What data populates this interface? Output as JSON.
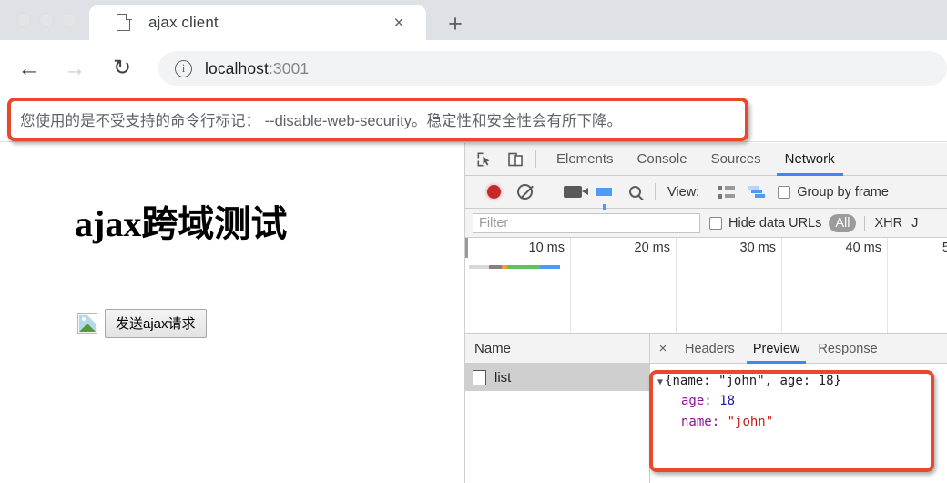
{
  "browser": {
    "tab": {
      "title": "ajax client",
      "favicon": "page-icon",
      "close": "×"
    },
    "new_tab": "+",
    "nav": {
      "back": "←",
      "forward": "→",
      "reload": "↻",
      "info": "i"
    },
    "url": {
      "host": "localhost",
      "port": ":3001"
    },
    "infobar": {
      "text": "您使用的是不受支持的命令行标记： --disable-web-security。稳定性和安全性会有所下降。"
    }
  },
  "page": {
    "heading": "ajax跨域测试",
    "button_label": "发送ajax请求"
  },
  "devtools": {
    "panels": [
      {
        "label": "Elements",
        "active": false
      },
      {
        "label": "Console",
        "active": false
      },
      {
        "label": "Sources",
        "active": false
      },
      {
        "label": "Network",
        "active": true
      }
    ],
    "toolbar": {
      "record": "record-icon",
      "clear": "clear-icon",
      "camera": "screenshot-icon",
      "filter": "filter-icon",
      "search": "search-icon",
      "view_label": "View:",
      "group_by_frame_label": "Group by frame"
    },
    "filterbar": {
      "filter_placeholder": "Filter",
      "hide_data_urls_label": "Hide data URLs",
      "types": [
        "All",
        "XHR",
        "J"
      ],
      "selected_type": "All"
    },
    "timeline": {
      "ticks": [
        "10 ms",
        "20 ms",
        "30 ms",
        "40 ms",
        "5"
      ],
      "waterfall_segments": [
        {
          "color": "#d8d8d8",
          "width": 22
        },
        {
          "color": "#8a7f7a",
          "width": 14
        },
        {
          "color": "#f0a032",
          "width": 6
        },
        {
          "color": "#5bc45b",
          "width": 36
        },
        {
          "color": "#4d9bf5",
          "width": 22
        }
      ]
    },
    "requests": {
      "column_header": "Name",
      "rows": [
        {
          "name": "list",
          "selected": true
        }
      ]
    },
    "detail": {
      "close": "×",
      "tabs": [
        {
          "label": "Headers",
          "active": false
        },
        {
          "label": "Preview",
          "active": true
        },
        {
          "label": "Response",
          "active": false
        }
      ],
      "preview": {
        "summary_prefix": "{name: ",
        "summary_name": "\"john\"",
        "summary_mid": ", age: ",
        "summary_age": "18",
        "summary_suffix": "}",
        "rows": [
          {
            "key": "age:",
            "value": "18",
            "type": "number"
          },
          {
            "key": "name:",
            "value": "\"john\"",
            "type": "string"
          }
        ]
      }
    }
  },
  "annotations": {
    "warning_box": "red-highlight-box",
    "preview_box": "red-highlight-box"
  },
  "colors": {
    "accent_blue": "#4285f4",
    "annotation_red": "#e8482c",
    "record_red": "#c62828",
    "json_key": "#881391",
    "json_number": "#1a1aa6",
    "json_string": "#c41a16"
  }
}
